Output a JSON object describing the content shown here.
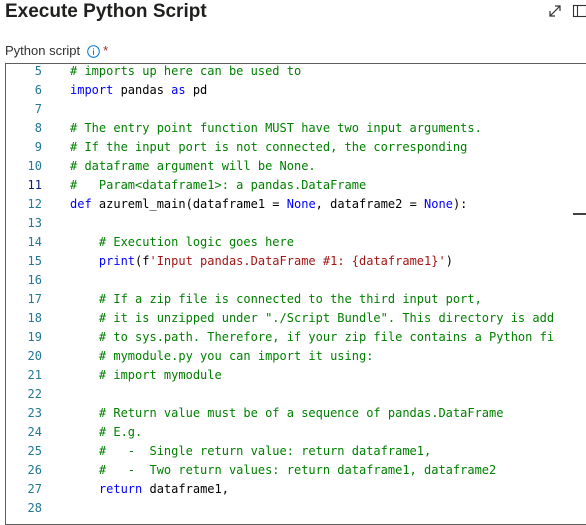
{
  "header": {
    "title": "Execute Python Script",
    "expand_icon": "expand-diagonal-icon",
    "panel_icon": "side-panel-icon"
  },
  "field": {
    "label": "Python script",
    "required_marker": "*",
    "info_icon": "info-circle-icon"
  },
  "colors": {
    "comment": "#008000",
    "keyword": "#0000ff",
    "string": "#a31515",
    "line_number": "#237893"
  },
  "editor": {
    "active_line": "11",
    "lines": [
      {
        "num": "5",
        "segs": [
          {
            "t": "# imports up here can be used to",
            "c": "comment"
          }
        ]
      },
      {
        "num": "6",
        "segs": [
          {
            "t": "import",
            "c": "kw"
          },
          {
            "t": " pandas ",
            "c": "plain"
          },
          {
            "t": "as",
            "c": "kw"
          },
          {
            "t": " pd",
            "c": "plain"
          }
        ]
      },
      {
        "num": "7",
        "segs": []
      },
      {
        "num": "8",
        "segs": [
          {
            "t": "# The entry point function MUST have two input arguments.",
            "c": "comment"
          }
        ]
      },
      {
        "num": "9",
        "segs": [
          {
            "t": "# If the input port is not connected, the corresponding",
            "c": "comment"
          }
        ]
      },
      {
        "num": "10",
        "segs": [
          {
            "t": "# dataframe argument will be None.",
            "c": "comment"
          }
        ]
      },
      {
        "num": "11",
        "segs": [
          {
            "t": "#   Param<dataframe1>: a pandas.DataFrame",
            "c": "comment"
          }
        ]
      },
      {
        "num": "12",
        "segs": [
          {
            "t": "def",
            "c": "kw"
          },
          {
            "t": " azureml_main(dataframe1 = ",
            "c": "plain"
          },
          {
            "t": "None",
            "c": "kw"
          },
          {
            "t": ", dataframe2 = ",
            "c": "plain"
          },
          {
            "t": "None",
            "c": "kw"
          },
          {
            "t": "):",
            "c": "plain"
          }
        ]
      },
      {
        "num": "13",
        "segs": []
      },
      {
        "num": "14",
        "segs": [
          {
            "t": "    # Execution logic goes here",
            "c": "comment"
          }
        ]
      },
      {
        "num": "15",
        "segs": [
          {
            "t": "    ",
            "c": "plain"
          },
          {
            "t": "print",
            "c": "kw"
          },
          {
            "t": "(f",
            "c": "plain"
          },
          {
            "t": "'Input pandas.DataFrame #1: {dataframe1}'",
            "c": "str"
          },
          {
            "t": ")",
            "c": "plain"
          }
        ]
      },
      {
        "num": "16",
        "segs": []
      },
      {
        "num": "17",
        "segs": [
          {
            "t": "    # If a zip file is connected to the third input port,",
            "c": "comment"
          }
        ]
      },
      {
        "num": "18",
        "segs": [
          {
            "t": "    # it is unzipped under \"./Script Bundle\". This directory is add",
            "c": "comment"
          }
        ]
      },
      {
        "num": "19",
        "segs": [
          {
            "t": "    # to sys.path. Therefore, if your zip file contains a Python fi",
            "c": "comment"
          }
        ]
      },
      {
        "num": "20",
        "segs": [
          {
            "t": "    # mymodule.py you can import it using:",
            "c": "comment"
          }
        ]
      },
      {
        "num": "21",
        "segs": [
          {
            "t": "    # import mymodule",
            "c": "comment"
          }
        ]
      },
      {
        "num": "22",
        "segs": []
      },
      {
        "num": "23",
        "segs": [
          {
            "t": "    # Return value must be of a sequence of pandas.DataFrame",
            "c": "comment"
          }
        ]
      },
      {
        "num": "24",
        "segs": [
          {
            "t": "    # E.g.",
            "c": "comment"
          }
        ]
      },
      {
        "num": "25",
        "segs": [
          {
            "t": "    #   -  Single return value: return dataframe1,",
            "c": "comment"
          }
        ]
      },
      {
        "num": "26",
        "segs": [
          {
            "t": "    #   -  Two return values: return dataframe1, dataframe2",
            "c": "comment"
          }
        ]
      },
      {
        "num": "27",
        "segs": [
          {
            "t": "    ",
            "c": "plain"
          },
          {
            "t": "return",
            "c": "kw"
          },
          {
            "t": " dataframe1,",
            "c": "plain"
          }
        ]
      },
      {
        "num": "28",
        "segs": []
      }
    ]
  }
}
